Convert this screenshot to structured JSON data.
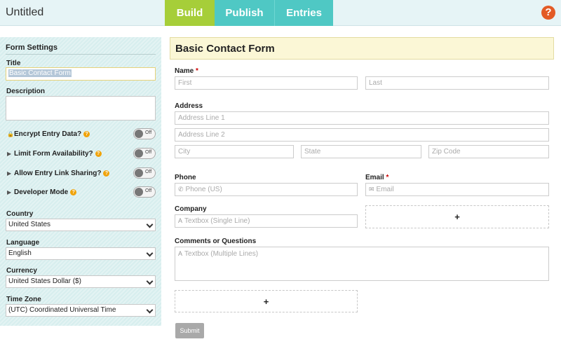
{
  "header": {
    "app_title": "Untitled",
    "tabs": [
      {
        "label": "Build"
      },
      {
        "label": "Publish"
      },
      {
        "label": "Entries"
      }
    ],
    "help_glyph": "?"
  },
  "sidebar": {
    "heading": "Form Settings",
    "title_label": "Title",
    "title_value": "Basic Contact Form",
    "description_label": "Description",
    "description_value": "",
    "toggles": [
      {
        "label": "Encrypt Entry Data?",
        "state": "Off",
        "lead_icon": "lock-icon"
      },
      {
        "label": "Limit Form Availability?",
        "state": "Off",
        "lead_icon": "caret-right-icon"
      },
      {
        "label": "Allow Entry Link Sharing?",
        "state": "Off",
        "lead_icon": "caret-right-icon"
      },
      {
        "label": "Developer Mode",
        "state": "Off",
        "lead_icon": "caret-right-icon"
      }
    ],
    "country_label": "Country",
    "country_value": "United States",
    "language_label": "Language",
    "language_value": "English",
    "currency_label": "Currency",
    "currency_value": "United States Dollar ($)",
    "timezone_label": "Time Zone",
    "timezone_value": "(UTC) Coordinated Universal Time"
  },
  "form": {
    "title": "Basic Contact Form",
    "name_label": "Name",
    "required_mark": "*",
    "first_placeholder": "First",
    "last_placeholder": "Last",
    "address_label": "Address",
    "address1_placeholder": "Address Line 1",
    "address2_placeholder": "Address Line 2",
    "city_placeholder": "City",
    "state_placeholder": "State",
    "zip_placeholder": "Zip Code",
    "phone_label": "Phone",
    "phone_placeholder": "Phone (US)",
    "email_label": "Email",
    "email_placeholder": "Email",
    "company_label": "Company",
    "company_placeholder": "Textbox (Single Line)",
    "comments_label": "Comments or Questions",
    "comments_placeholder": "Textbox (Multiple Lines)",
    "add_glyph": "+",
    "submit_label": "Submit"
  },
  "colors": {
    "build_tab": "#a6ce39",
    "publish_tab": "#4fc8c4",
    "help": "#e35b26",
    "title_bar": "#fbf7d6"
  }
}
